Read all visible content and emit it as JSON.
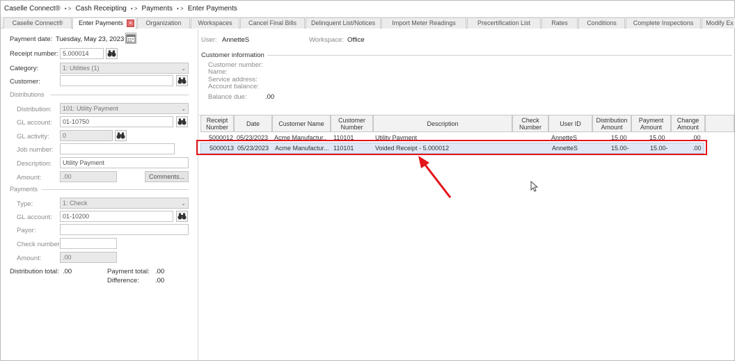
{
  "breadcrumb": {
    "items": [
      "Caselle Connect®",
      "Cash Receipting",
      "Payments",
      "Enter Payments"
    ],
    "separator": "• >"
  },
  "tabs": [
    {
      "label": "Caselle Connect®"
    },
    {
      "label": "Enter Payments",
      "active": true
    },
    {
      "label": "Organization"
    },
    {
      "label": "Workspaces"
    },
    {
      "label": "Cancel Final Bills"
    },
    {
      "label": "Delinquent List/Notices"
    },
    {
      "label": "Import Meter Readings"
    },
    {
      "label": "Precertification List"
    },
    {
      "label": "Rates"
    },
    {
      "label": "Conditions"
    },
    {
      "label": "Complete Inspections"
    },
    {
      "label": "Modify Ex"
    }
  ],
  "left": {
    "payment_date_label": "Payment date:",
    "payment_date_value": "Tuesday, May 23, 2023",
    "receipt_number_label": "Receipt number:",
    "receipt_number_value": "5.000014",
    "category_label": "Category:",
    "category_value": "1: Utilities (1)",
    "customer_label": "Customer:",
    "customer_value": "",
    "distributions_section": "Distributions",
    "distribution_label": "Distribution:",
    "distribution_value": "101: Utility Payment",
    "gl_account_label": "GL account:",
    "gl_account_value": "01-10750",
    "gl_activity_label": "GL activity:",
    "gl_activity_value": "0",
    "job_number_label": "Job number:",
    "job_number_value": "",
    "description_label": "Description:",
    "description_value": "Utility Payment",
    "amount_label": "Amount:",
    "amount_value": ".00",
    "comments_button": "Comments...",
    "payments_section": "Payments",
    "type_label": "Type:",
    "type_value": "1: Check",
    "pay_gl_account_label": "GL account:",
    "pay_gl_account_value": "01-10200",
    "payor_label": "Payor:",
    "payor_value": "",
    "check_number_label": "Check number:",
    "check_number_value": "",
    "pay_amount_label": "Amount:",
    "pay_amount_value": ".00",
    "distribution_total_label": "Distribution total:",
    "distribution_total_value": ".00",
    "payment_total_label": "Payment total:",
    "payment_total_value": ".00",
    "difference_label": "Difference:",
    "difference_value": ".00"
  },
  "right": {
    "user_label": "User:",
    "user_value": "AnnetteS",
    "workspace_label": "Workspace:",
    "workspace_value": "Office",
    "customer_info_title": "Customer information",
    "customer_number_label": "Customer number:",
    "name_label": "Name:",
    "service_address_label": "Service address:",
    "account_balance_label": "Account balance:",
    "balance_due_label": "Balance due:",
    "balance_due_value": ".00"
  },
  "grid": {
    "columns": [
      "Receipt Number",
      "Date",
      "Customer Name",
      "Customer Number",
      "Description",
      "Check Number",
      "User ID",
      "Distribution Amount",
      "Payment Amount",
      "Change Amount"
    ],
    "rows": [
      [
        "5000012",
        "05/23/2023",
        "Acme Manufactur...",
        "110101",
        "Utility Payment",
        "",
        "AnnetteS",
        "15.00",
        "15.00",
        ".00"
      ],
      [
        "5000013",
        "05/23/2023",
        "Acme Manufactur...",
        "110101",
        "Voided Receipt - 5.000012",
        "",
        "AnnetteS",
        "15.00-",
        "15.00-",
        ".00"
      ]
    ]
  },
  "colors": {
    "highlight": "#e3141b",
    "selection": "#dfe8f4",
    "tab_close": "#e36b6b"
  }
}
